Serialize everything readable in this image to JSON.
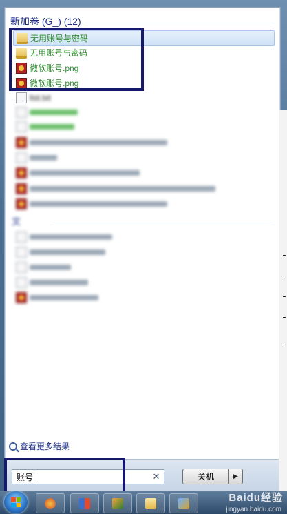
{
  "results_group": {
    "header": "新加卷 (G_) (12)",
    "items": [
      {
        "label": "无用账号与密码",
        "icon": "folder-icon",
        "selected": true
      },
      {
        "label": "无用账号与密码",
        "icon": "folder-icon",
        "selected": false
      },
      {
        "label": "微软账号.png",
        "icon": "png-icon",
        "selected": false
      },
      {
        "label": "微软账号.png",
        "icon": "png-icon",
        "selected": false
      },
      {
        "label": "list.txt",
        "icon": "doc-icon",
        "selected": false
      }
    ]
  },
  "section2": {
    "header": "文"
  },
  "see_more": {
    "label": "查看更多结果"
  },
  "search": {
    "value": "账号"
  },
  "shutdown": {
    "label": "关机"
  },
  "watermark": {
    "brand": "Baidu经验",
    "url": "jingyan.baidu.com"
  },
  "colors": {
    "highlight_box": "#15186b",
    "result_text": "#2e8b2e",
    "header_text": "#1e3287"
  }
}
